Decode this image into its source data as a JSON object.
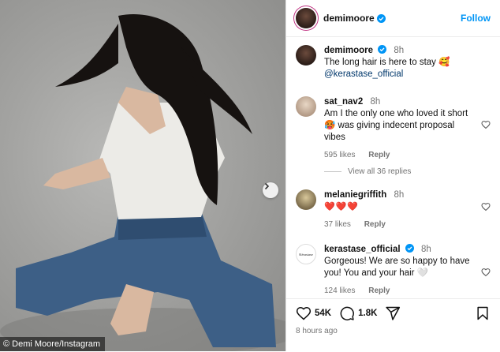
{
  "photo": {
    "credit": "© Demi Moore/Instagram"
  },
  "post": {
    "username": "demimoore",
    "follow_label": "Follow",
    "caption": {
      "username": "demimoore",
      "time": "8h",
      "text": "The long hair is here to stay 🥰",
      "mention": "@kerastase_official"
    }
  },
  "comments": [
    {
      "username": "sat_nav2",
      "time": "8h",
      "text": "Am I the only one who loved it short 🥵 was giving indecent proposal vibes",
      "likes": "595 likes",
      "reply": "Reply",
      "view_replies": "View all 36 replies"
    },
    {
      "username": "melaniegriffith",
      "time": "8h",
      "text": "❤️❤️❤️",
      "likes": "37 likes",
      "reply": "Reply"
    },
    {
      "username": "kerastase_official",
      "time": "8h",
      "text": "Gorgeous! We are so happy to have you! You and your hair 🤍",
      "likes": "124 likes",
      "reply": "Reply",
      "avatar_text": "Kérastase"
    }
  ],
  "actions": {
    "likes": "54K",
    "comments": "1.8K",
    "ago": "8 hours ago"
  },
  "colors": {
    "link": "#0095f6",
    "muted": "#737373",
    "verified": "#0095f6",
    "heart": "#ed1c3a"
  },
  "icons": [
    "chevron-right-icon",
    "verified-icon",
    "heart-icon",
    "comment-icon",
    "share-icon",
    "bookmark-icon"
  ]
}
